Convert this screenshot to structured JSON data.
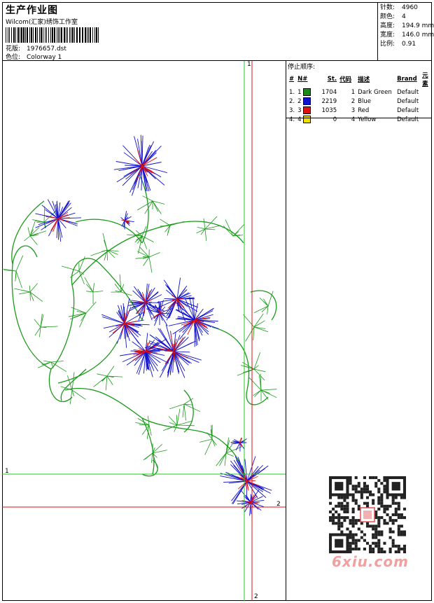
{
  "header": {
    "title": "生产作业图",
    "studio": "Wilcom(汇家)绣饰工作室",
    "design_label": "花版:",
    "design_value": "1976657.dst",
    "colorway_label": "色位:",
    "colorway_value": "Colorway 1"
  },
  "stats": [
    {
      "label": "针数:",
      "value": "4960"
    },
    {
      "label": "颜色:",
      "value": "4"
    },
    {
      "label": "高度:",
      "value": "194.9 mm"
    },
    {
      "label": "宽度:",
      "value": "146.0 mm"
    },
    {
      "label": "比例:",
      "value": "0.91"
    }
  ],
  "stop_sequence": {
    "title": "停止顺序:",
    "headers": [
      "#",
      "N#",
      "St.",
      "代码",
      "描述",
      "Brand",
      "元素"
    ],
    "rows": [
      {
        "idx": "1.",
        "n": "1",
        "color": "#1a8a1a",
        "st": "1704",
        "code": "1",
        "desc": "Dark Green",
        "brand": "Default"
      },
      {
        "idx": "2.",
        "n": "2",
        "color": "#1010d0",
        "st": "2219",
        "code": "2",
        "desc": "Blue",
        "brand": "Default"
      },
      {
        "idx": "3.",
        "n": "3",
        "color": "#e01010",
        "st": "1035",
        "code": "3",
        "desc": "Red",
        "brand": "Default"
      },
      {
        "idx": "4.",
        "n": "4",
        "color": "#f0e000",
        "st": "0",
        "code": "4",
        "desc": "Yellow",
        "brand": "Default"
      }
    ]
  },
  "markers": {
    "green_v": "1",
    "green_h": "1",
    "red_h": "2",
    "red_v": "2"
  },
  "watermark": "6xiu.com",
  "colors": {
    "green_line": "#22cc22",
    "red_line": "#dd1111",
    "thread_green": "#1a9a1a",
    "thread_blue": "#1010d0",
    "thread_red": "#e01010"
  }
}
